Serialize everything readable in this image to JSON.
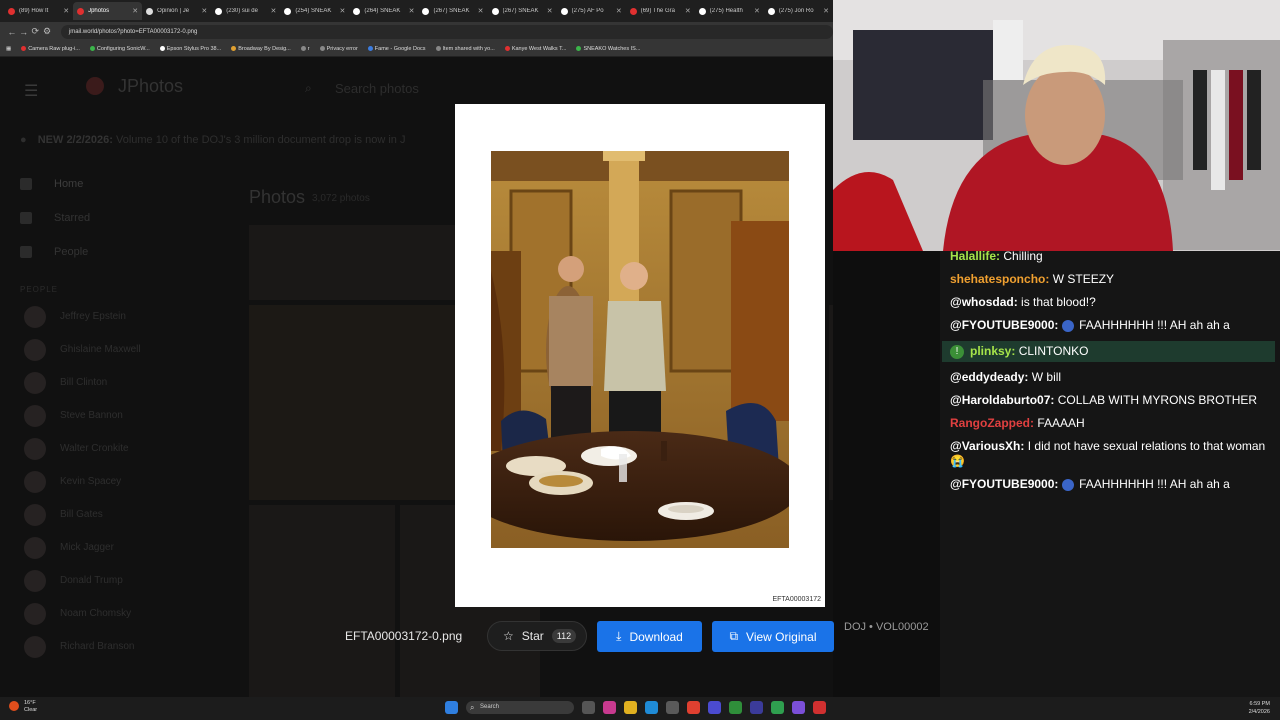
{
  "browser": {
    "tabs": [
      {
        "label": "(89) How It",
        "color": "#e03030"
      },
      {
        "label": "Jphotos",
        "color": "#e03030",
        "active": true
      },
      {
        "label": "Opinion | Je",
        "color": "#dddddd"
      },
      {
        "label": "(230) sui de",
        "color": "#ffffff"
      },
      {
        "label": "(254) SNEAK",
        "color": "#ffffff"
      },
      {
        "label": "(264) SNEAK",
        "color": "#ffffff"
      },
      {
        "label": "(267) SNEAK",
        "color": "#ffffff"
      },
      {
        "label": "(267) SNEAK",
        "color": "#ffffff"
      },
      {
        "label": "(275) AF Po",
        "color": "#ffffff"
      },
      {
        "label": "(69) The Gra",
        "color": "#e03030"
      },
      {
        "label": "(275) Health",
        "color": "#ffffff"
      },
      {
        "label": "(275) Jon Ro",
        "color": "#ffffff"
      }
    ],
    "url": "jmail.world/photos?photo=EFTA00003172-0.png",
    "bookmarks": [
      {
        "label": "Camera Raw plug-i...",
        "color": "#e03030"
      },
      {
        "label": "Configuring SonicW...",
        "color": "#3bb54a"
      },
      {
        "label": "Epson Stylus Pro 38...",
        "color": "#ffffff"
      },
      {
        "label": "Broadway By Desig...",
        "color": "#e0a030"
      },
      {
        "label": "r",
        "color": "#888888"
      },
      {
        "label": "Privacy error",
        "color": "#888888"
      },
      {
        "label": "Fame - Google Docs",
        "color": "#3c7de0"
      },
      {
        "label": "Item shared with yo...",
        "color": "#888888"
      },
      {
        "label": "Kanye West Walks T...",
        "color": "#e03030"
      },
      {
        "label": "SNEAKO Watches IS...",
        "color": "#3bb54a"
      }
    ]
  },
  "app": {
    "logo": "JPhotos",
    "search_placeholder": "Search photos",
    "banner_label": "NEW 2/2/2026:",
    "banner_text": "Volume 10 of the DOJ's 3 million document drop is now in J",
    "nav": [
      {
        "label": "Home"
      },
      {
        "label": "Starred"
      },
      {
        "label": "People"
      }
    ],
    "people_section": "PEOPLE",
    "people": [
      "Jeffrey Epstein",
      "Ghislaine Maxwell",
      "Bill Clinton",
      "Steve Bannon",
      "Walter Cronkite",
      "Kevin Spacey",
      "Bill Gates",
      "Mick Jagger",
      "Donald Trump",
      "Noam Chomsky",
      "Richard Branson"
    ],
    "photos_title": "Photos",
    "photos_count": "3,072 photos"
  },
  "viewer": {
    "photo_id": "EFTA00003172",
    "filename": "EFTA00003172-0.png",
    "star_label": "Star",
    "star_count": "112",
    "download_label": "Download",
    "view_original_label": "View Original",
    "source": "DOJ • VOL00002"
  },
  "chat": {
    "messages": [
      {
        "user": "Halallife:",
        "user_color": "#a6e44a",
        "text": "Chilling"
      },
      {
        "user": "shehatesponcho:",
        "user_color": "#f0a030",
        "text": "W STEEZY"
      },
      {
        "user": "@whosdad:",
        "user_color": "#ffffff",
        "text": "is that blood!?"
      },
      {
        "user": "@FYOUTUBE9000:",
        "user_color": "#ffffff",
        "emoji": true,
        "text": "FAAHHHHHH !!! AH ah ah a"
      },
      {
        "user": "plinksy:",
        "user_color": "#a6e44a",
        "badge": "!",
        "highlight": true,
        "text": "CLINTONKO"
      },
      {
        "user": "@eddydeady:",
        "user_color": "#ffffff",
        "text": "W bill"
      },
      {
        "user": "@Haroldaburto07:",
        "user_color": "#ffffff",
        "text": "COLLAB WITH MYRONS BROTHER"
      },
      {
        "user": "RangoZapped:",
        "user_color": "#e04040",
        "text": "FAAAAH"
      },
      {
        "user": "@VariousXh:",
        "user_color": "#ffffff",
        "text": "I did not have sexual relations to that woman 😭"
      },
      {
        "user": "@FYOUTUBE9000:",
        "user_color": "#ffffff",
        "emoji": true,
        "text": "FAAHHHHHH !!! AH ah ah a"
      }
    ]
  },
  "taskbar": {
    "weather_temp": "16°F",
    "weather_text": "Clear",
    "search_placeholder": "Search",
    "time": "6:59 PM",
    "date": "2/4/2026"
  }
}
